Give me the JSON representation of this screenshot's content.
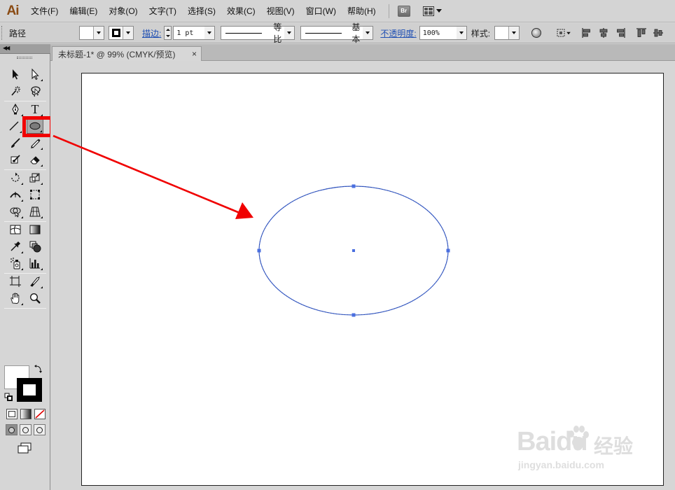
{
  "app": {
    "logo_text": "Ai",
    "accent_color": "#8a4b14"
  },
  "menu": {
    "items": [
      "文件(F)",
      "编辑(E)",
      "对象(O)",
      "文字(T)",
      "选择(S)",
      "效果(C)",
      "视图(V)",
      "窗口(W)",
      "帮助(H)"
    ],
    "bridge_label": "Br"
  },
  "control": {
    "path_label": "路径",
    "stroke_link": "描边:",
    "stroke_weight": "1 pt",
    "profile_label": "等比",
    "brush_label": "基本",
    "opacity_link": "不透明度:",
    "opacity_value": "100%",
    "style_label": "样式:"
  },
  "document": {
    "tab_title": "未标题-1* @ 99% (CMYK/预览)",
    "close_glyph": "×"
  },
  "tools": {
    "type_glyph": "T",
    "highlighted_tool": "ellipse-tool",
    "highlight_color": "#f00000"
  },
  "canvas": {
    "ellipse_stroke_color": "#3a5fcd",
    "annotation_arrow_color": "#f00000"
  },
  "watermark": {
    "brand": "Baidu",
    "product": "经验",
    "url": "jingyan.baidu.com"
  }
}
